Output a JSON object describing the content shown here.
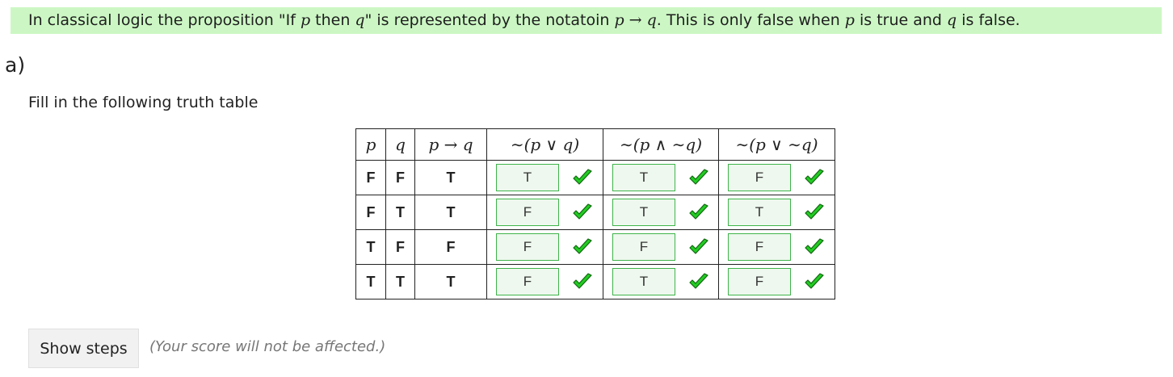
{
  "intro": {
    "part1": "In classical logic the proposition \"If ",
    "p": "p",
    "part2": " then ",
    "q": "q",
    "part3": "\" is represented by the notatoin ",
    "formula_p": "p",
    "arrow": " → ",
    "formula_q": "q",
    "part4": ". This is only false when ",
    "p2": "p",
    "part5": " is true and ",
    "q2": "q",
    "part6": " is false."
  },
  "part_label": "a)",
  "instruction": "Fill in the following truth table",
  "table": {
    "headers": [
      "p",
      "q",
      "p → q",
      "∼(p ∨ q)",
      "∼(p ∧ ∼q)",
      "∼(p ∨ ∼q)"
    ],
    "rows": [
      {
        "p": "F",
        "q": "F",
        "impl": "T",
        "a1": "T",
        "a2": "T",
        "a3": "F"
      },
      {
        "p": "F",
        "q": "T",
        "impl": "T",
        "a1": "F",
        "a2": "T",
        "a3": "T"
      },
      {
        "p": "T",
        "q": "F",
        "impl": "F",
        "a1": "F",
        "a2": "F",
        "a3": "F"
      },
      {
        "p": "T",
        "q": "T",
        "impl": "T",
        "a1": "F",
        "a2": "T",
        "a3": "F"
      }
    ]
  },
  "icons": {
    "correct": "checkmark-icon",
    "correct_color": "#22cc22"
  },
  "show_steps_label": "Show steps",
  "note": "(Your score will not be affected.)"
}
